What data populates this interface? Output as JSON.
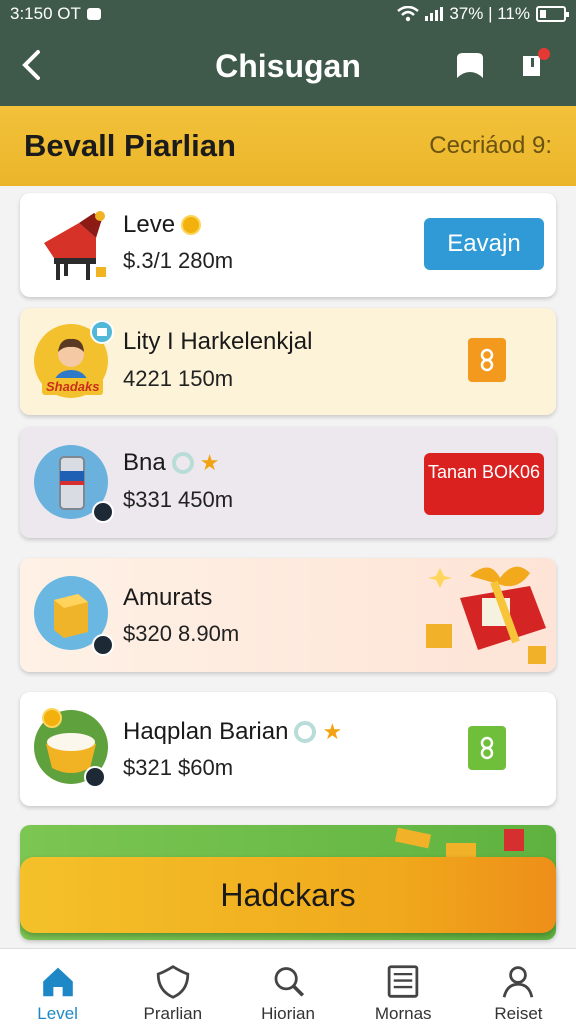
{
  "status": {
    "time": "3:150 OT",
    "battery_text": "37% | 11%"
  },
  "header": {
    "title": "Chisugan"
  },
  "banner": {
    "title": "Bevall Piarlian",
    "right_text": "Cecriáod 9:"
  },
  "items": [
    {
      "name": "Leve",
      "price": "$.3/1 280m",
      "action_label": "Eavajn"
    },
    {
      "name": "Lity I Harkelenkjal",
      "price": "4221 150m",
      "thumb_label": "Shadaks"
    },
    {
      "name": "Bna",
      "price": "$331 450m",
      "action_label": "Tanan BOK06"
    },
    {
      "name": "Amurats",
      "price": "$320 8.90m"
    },
    {
      "name": "Haqplan Barian",
      "price": "$321 $60m"
    }
  ],
  "bottom_button": {
    "label": "Hadckars"
  },
  "nav": [
    {
      "label": "Level",
      "icon": "home-icon"
    },
    {
      "label": "Prarlian",
      "icon": "shield-icon"
    },
    {
      "label": "Hiorian",
      "icon": "search-icon"
    },
    {
      "label": "Mornas",
      "icon": "list-icon"
    },
    {
      "label": "Reiset",
      "icon": "user-icon"
    }
  ],
  "colors": {
    "header": "#3f5a4a",
    "banner": "#f3c23a",
    "active_nav": "#1e88c7"
  }
}
